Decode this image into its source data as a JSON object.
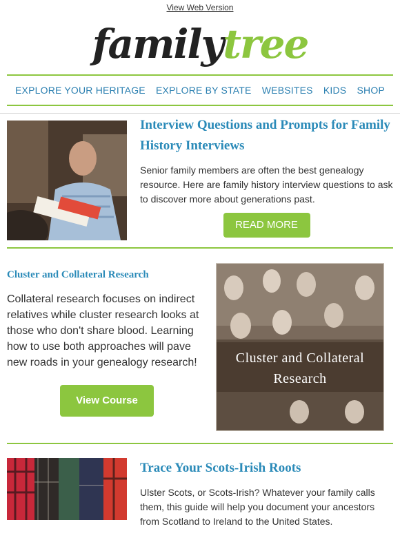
{
  "topbar": {
    "view_web": "View Web Version"
  },
  "logo": {
    "part1": "family",
    "part2": "tree"
  },
  "nav": [
    "EXPLORE YOUR HERITAGE",
    "EXPLORE BY STATE",
    "WEBSITES",
    "KIDS",
    "SHOP"
  ],
  "articles": [
    {
      "title": "Interview Questions and Prompts for Family History Interviews",
      "body": "Senior family members are often the best genealogy resource. Here are family history interview questions to ask to discover more about generations past.",
      "button": "READ MORE"
    },
    {
      "title": "Cluster and Collateral Research",
      "body": "Collateral research focuses on indirect relatives while cluster research looks at those who don't share blood. Learning how to use both approaches will pave new roads in your genealogy research!",
      "button": "View Course",
      "image_caption": "Cluster and Collateral Research"
    },
    {
      "title": "Trace Your Scots-Irish Roots",
      "body": "Ulster Scots, or Scots-Irish? Whatever your family calls them, this guide will help you document your ancestors from Scotland to Ireland to the United States."
    }
  ],
  "colors": {
    "accent_green": "#8cc63f",
    "link_blue": "#2a7fb0",
    "headline_blue": "#2a8ab8"
  }
}
